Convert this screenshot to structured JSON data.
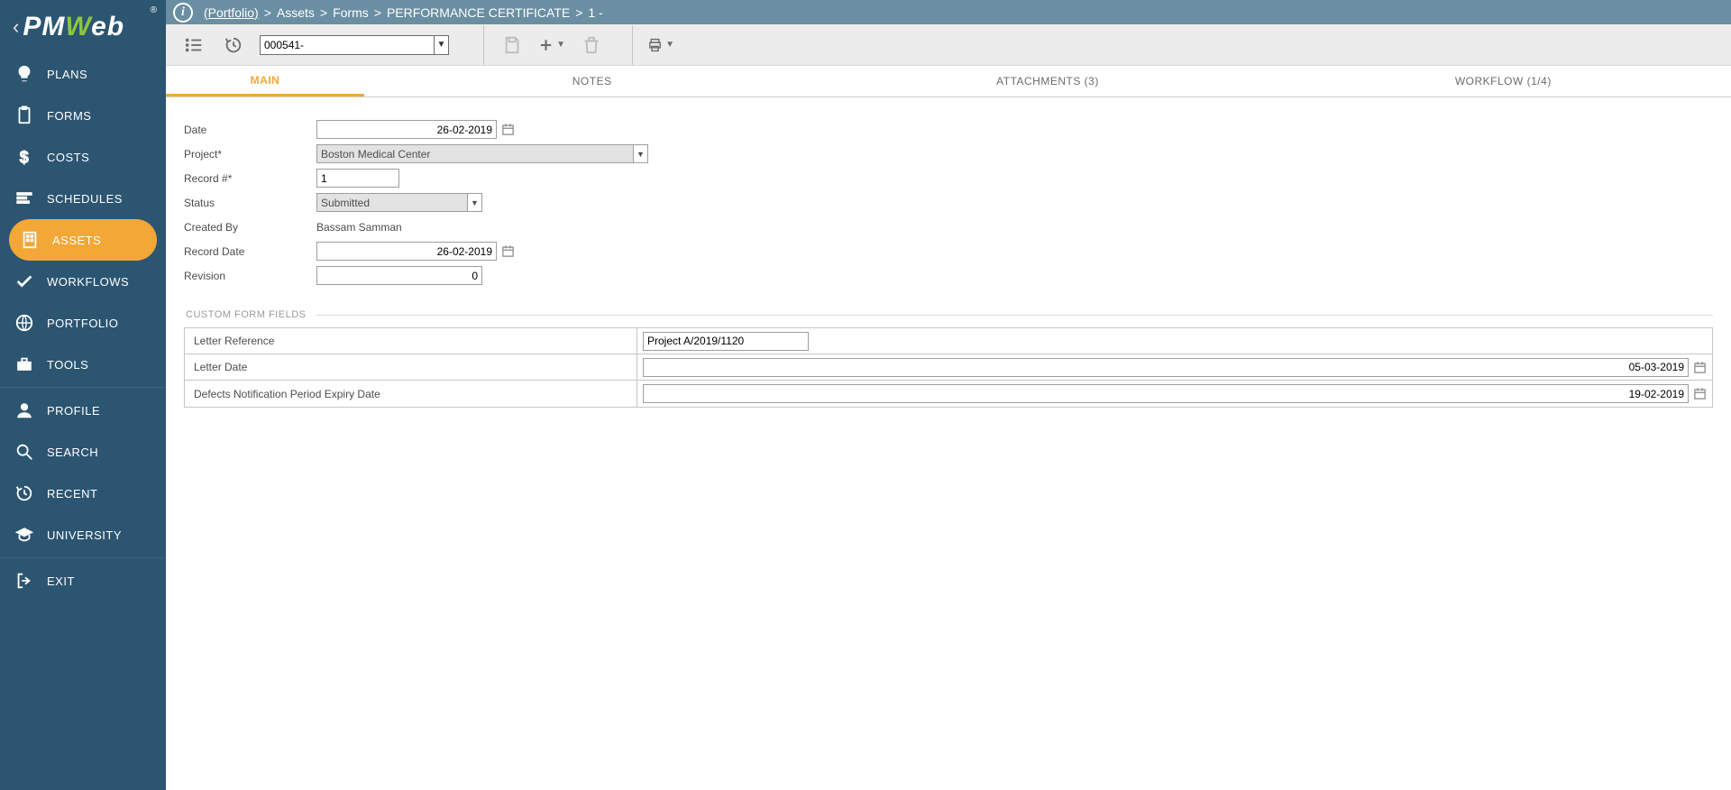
{
  "logo": {
    "pm": "PM",
    "w": "W",
    "eb": "eb"
  },
  "breadcrumb": {
    "portfolio": "(Portfolio)",
    "seg1": "Assets",
    "seg2": "Forms",
    "seg3": "PERFORMANCE CERTIFICATE",
    "seg4": "1",
    "seg5": "-"
  },
  "toolbar": {
    "record_selector": "000541-"
  },
  "tabs": {
    "main": "MAIN",
    "notes": "NOTES",
    "attachments": "ATTACHMENTS (3)",
    "workflow": "WORKFLOW (1/4)"
  },
  "form": {
    "labels": {
      "date": "Date",
      "project": "Project*",
      "record_no": "Record #*",
      "status": "Status",
      "created_by": "Created By",
      "record_date": "Record Date",
      "revision": "Revision"
    },
    "values": {
      "date": "26-02-2019",
      "project": "Boston Medical Center",
      "record_no": "1",
      "status": "Submitted",
      "created_by": "Bassam Samman",
      "record_date": "26-02-2019",
      "revision": "0"
    }
  },
  "custom_section_title": "CUSTOM FORM FIELDS",
  "custom_fields": [
    {
      "label": "Letter Reference",
      "value": "Project A/2019/1120",
      "type": "text"
    },
    {
      "label": "Letter Date",
      "value": "05-03-2019",
      "type": "date"
    },
    {
      "label": "Defects Notification Period Expiry Date",
      "value": "19-02-2019",
      "type": "date"
    }
  ],
  "sidebar": {
    "items": [
      {
        "label": "PLANS"
      },
      {
        "label": "FORMS"
      },
      {
        "label": "COSTS"
      },
      {
        "label": "SCHEDULES"
      },
      {
        "label": "ASSETS"
      },
      {
        "label": "WORKFLOWS"
      },
      {
        "label": "PORTFOLIO"
      },
      {
        "label": "TOOLS"
      }
    ],
    "lower": [
      {
        "label": "PROFILE"
      },
      {
        "label": "SEARCH"
      },
      {
        "label": "RECENT"
      },
      {
        "label": "UNIVERSITY"
      }
    ],
    "exit": "EXIT"
  }
}
